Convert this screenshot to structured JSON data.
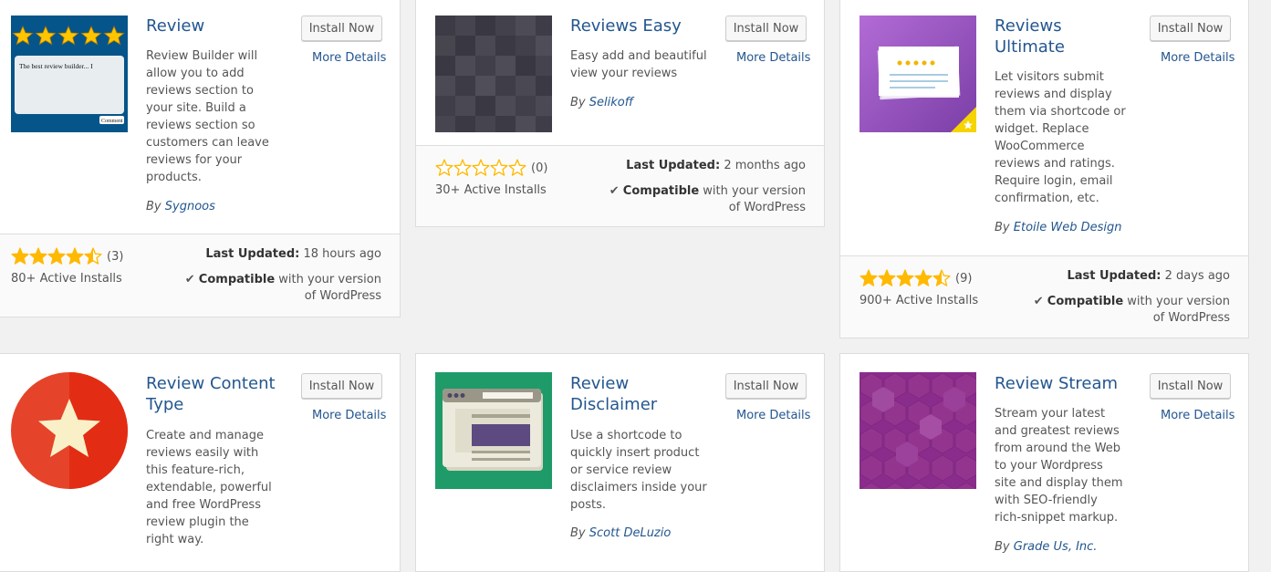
{
  "buttons": {
    "install": "Install Now",
    "more": "More Details"
  },
  "labels": {
    "by": "By",
    "last_updated": "Last Updated:",
    "compatible": "Compatible",
    "compatible_rest": "with your version of WordPress"
  },
  "plugins": [
    {
      "name": "Review",
      "description": "Review Builder will allow you to add reviews section to your site. Build a reviews section so customers can leave reviews for your products.",
      "author": "Sygnoos",
      "rating": 4.5,
      "rating_count": "(3)",
      "installs": "80+ Active Installs",
      "last_updated": "18 hours ago",
      "thumb_text": "The best review builder... I",
      "thumb_button": "Comment"
    },
    {
      "name": "Reviews Easy",
      "description": "Easy add and beautiful view your reviews",
      "author": "Selikoff",
      "rating": 0,
      "rating_count": "(0)",
      "installs": "30+ Active Installs",
      "last_updated": "2 months ago"
    },
    {
      "name": "Reviews Ultimate",
      "description": "Let visitors submit reviews and display them via shortcode or widget. Replace WooCommerce reviews and ratings. Require login, email confirmation, etc.",
      "author": "Etoile Web Design",
      "rating": 4.5,
      "rating_count": "(9)",
      "installs": "900+ Active Installs",
      "last_updated": "2 days ago"
    },
    {
      "name": "Review Content Type",
      "description": "Create and manage reviews easily with this feature-rich, extendable, powerful and free WordPress review plugin the right way."
    },
    {
      "name": "Review Disclaimer",
      "description": "Use a shortcode to quickly insert product or service review disclaimers inside your posts.",
      "author": "Scott DeLuzio"
    },
    {
      "name": "Review Stream",
      "description": "Stream your latest and greatest reviews from around the Web to your Wordpress site and display them with SEO-friendly rich-snippet markup.",
      "author": "Grade Us, Inc."
    }
  ],
  "colors": {
    "link": "#23568f",
    "star": "#ffb900",
    "background": "#f1f1f1"
  }
}
